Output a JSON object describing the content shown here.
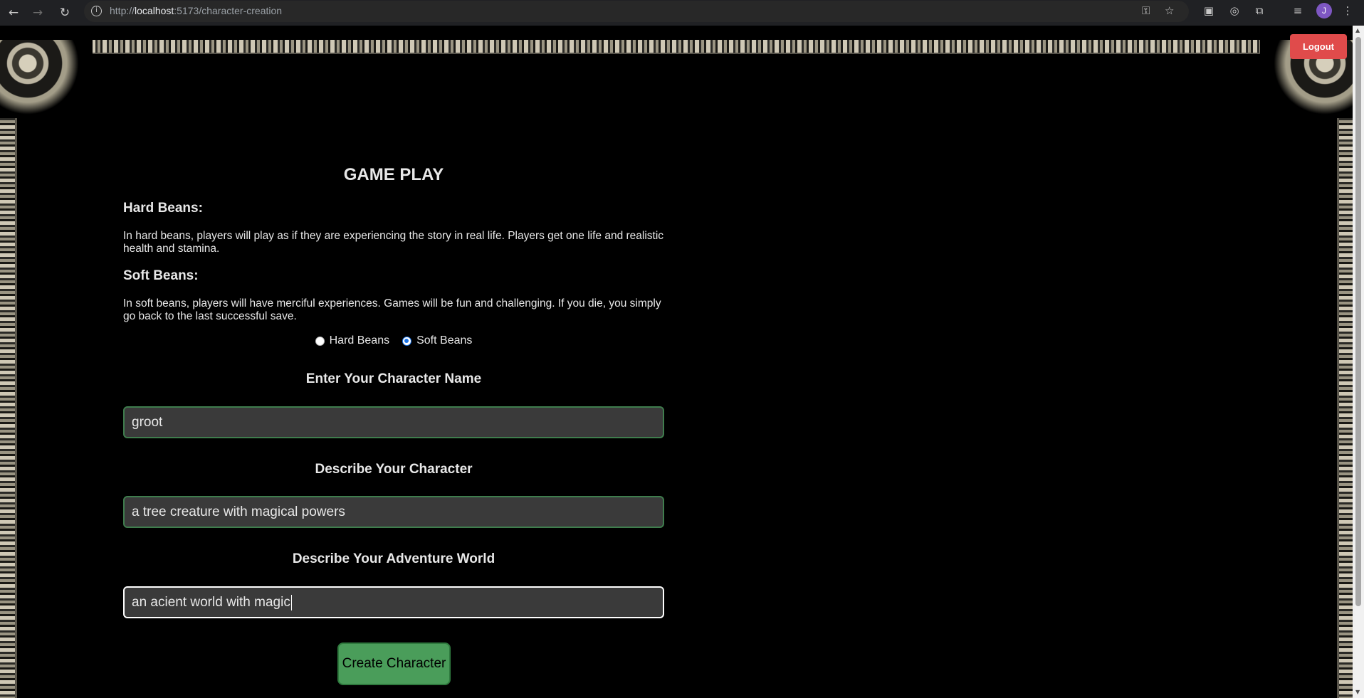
{
  "browser": {
    "url_prefix": "http://",
    "url_host": "localhost",
    "url_rest": ":5173/character-creation",
    "avatar_letter": "J"
  },
  "header": {
    "logout_label": "Logout"
  },
  "rules": {
    "title": "GAME PLAY",
    "hard_heading": "Hard Beans:",
    "hard_text": "In hard beans, players will play as if they are experiencing the story in real life. Players get one life and realistic health and stamina.",
    "soft_heading": "Soft Beans:",
    "soft_text": "In soft beans, players will have merciful experiences. Games will be fun and challenging. If you die, you simply go back to the last successful save."
  },
  "difficulty": {
    "options": [
      "Hard Beans",
      "Soft Beans"
    ],
    "selected": "Soft Beans"
  },
  "form": {
    "name_label": "Enter Your Character Name",
    "name_value": "groot",
    "description_label": "Describe Your Character",
    "description_value": "a tree creature with magical powers",
    "world_label": "Describe Your Adventure World",
    "world_value": "an acient world with magic",
    "submit_label": "Create Character"
  },
  "colors": {
    "logout_bg": "#e04b4b",
    "input_border": "#3f7d4d",
    "button_bg": "#4a9d5a",
    "radio_accent": "#1a73e8"
  }
}
